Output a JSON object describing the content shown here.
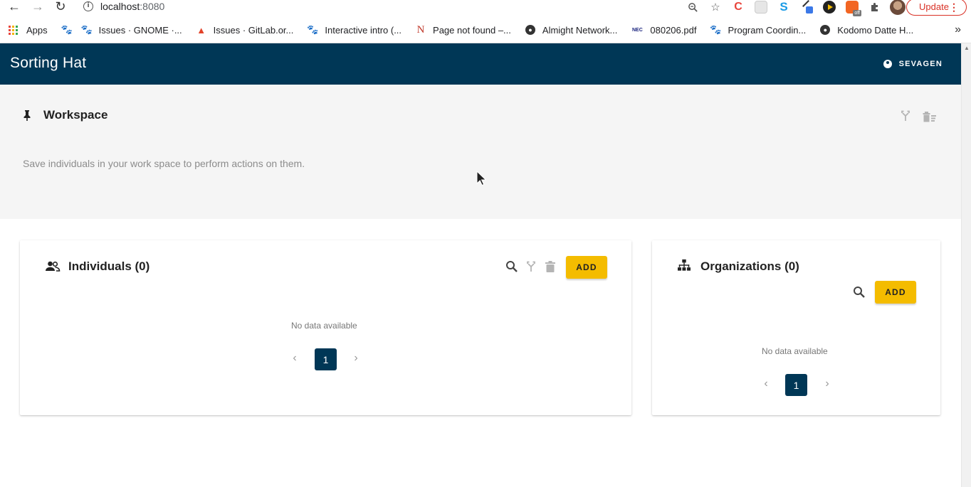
{
  "browser": {
    "url_host": "localhost",
    "url_port": ":8080",
    "update_label": "Update",
    "bookmarks": [
      {
        "label": "Apps",
        "icon": "apps-grid-icon"
      },
      {
        "label": "",
        "icon": "gnome-foot-icon"
      },
      {
        "label": "Issues · GNOME ·...",
        "icon": "gnome-foot-icon"
      },
      {
        "label": "Issues · GitLab.or...",
        "icon": "gitlab-icon"
      },
      {
        "label": "Interactive intro (...",
        "icon": "gnome-foot-icon"
      },
      {
        "label": "Page not found –...",
        "icon": "n-logo-icon"
      },
      {
        "label": "Almight Network...",
        "icon": "globe-icon"
      },
      {
        "label": "080206.pdf",
        "icon": "nec-icon"
      },
      {
        "label": "Program Coordin...",
        "icon": "gnome-foot-icon"
      },
      {
        "label": "Kodomo Datte H...",
        "icon": "globe-icon"
      }
    ]
  },
  "app": {
    "title": "Sorting Hat",
    "user": "SEVAGEN",
    "brand_color": "#003756",
    "accent_color": "#f4bc00"
  },
  "workspace": {
    "title": "Workspace",
    "description": "Save individuals in your work space to perform actions on them."
  },
  "individuals": {
    "title": "Individuals (0)",
    "add_label": "ADD",
    "empty_text": "No data available",
    "page": "1"
  },
  "organizations": {
    "title": "Organizations (0)",
    "add_label": "ADD",
    "empty_text": "No data available",
    "page": "1"
  }
}
